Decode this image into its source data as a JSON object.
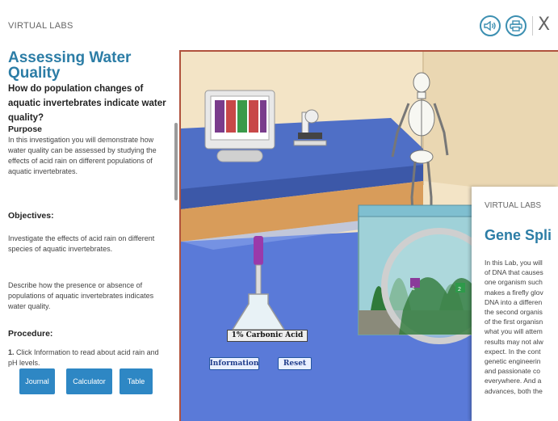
{
  "header": {
    "app_label": "VIRTUAL LABS",
    "audio_icon": "speaker-icon",
    "print_icon": "printer-icon",
    "close_icon": "close-icon",
    "close_glyph": "X"
  },
  "left_panel": {
    "title": "Assessing Water Quality",
    "question": "How do population changes of aquatic invertebrates indicate water quality?",
    "purpose_heading": "Purpose",
    "purpose_text": "In this investigation you will demonstrate how water quality can be assessed by studying the effects of acid rain on different populations of aquatic invertebrates.",
    "objectives_heading": "Objectives:",
    "objective_1": "Investigate the effects of acid rain on different species of aquatic invertebrates.",
    "objective_2": "Describe how the presence or absence of populations of aquatic invertebrates indicates water quality.",
    "procedure_heading": "Procedure:",
    "procedure_num": "1.",
    "procedure_step_1": " Click Information to read about acid rain and pH levels.",
    "buttons": {
      "journal": "Journal",
      "calculator": "Calculator",
      "table": "Table"
    }
  },
  "scene": {
    "flask_label": "1% Carbonic Acid",
    "information_button": "Information",
    "reset_button": "Reset",
    "invertebrate_markers": [
      "1",
      "2"
    ]
  },
  "overlay_card": {
    "label": "VIRTUAL LABS",
    "title": "Gene Spli",
    "text_lines": [
      "In this Lab, you will",
      "of DNA that causes",
      "one organism such",
      "makes a firefly glov",
      "DNA into a differen",
      "the second organis",
      "of the first organisn",
      "what you will attem",
      "results may not alw",
      "expect. In the cont",
      "genetic engineerin",
      "and passionate co",
      "everywhere. And a",
      "advances, both the"
    ]
  },
  "colors": {
    "accent": "#2c7da6",
    "button_blue": "#2e87c4",
    "scene_border": "#b0523d",
    "bench_blue": "#4f6fc6"
  }
}
